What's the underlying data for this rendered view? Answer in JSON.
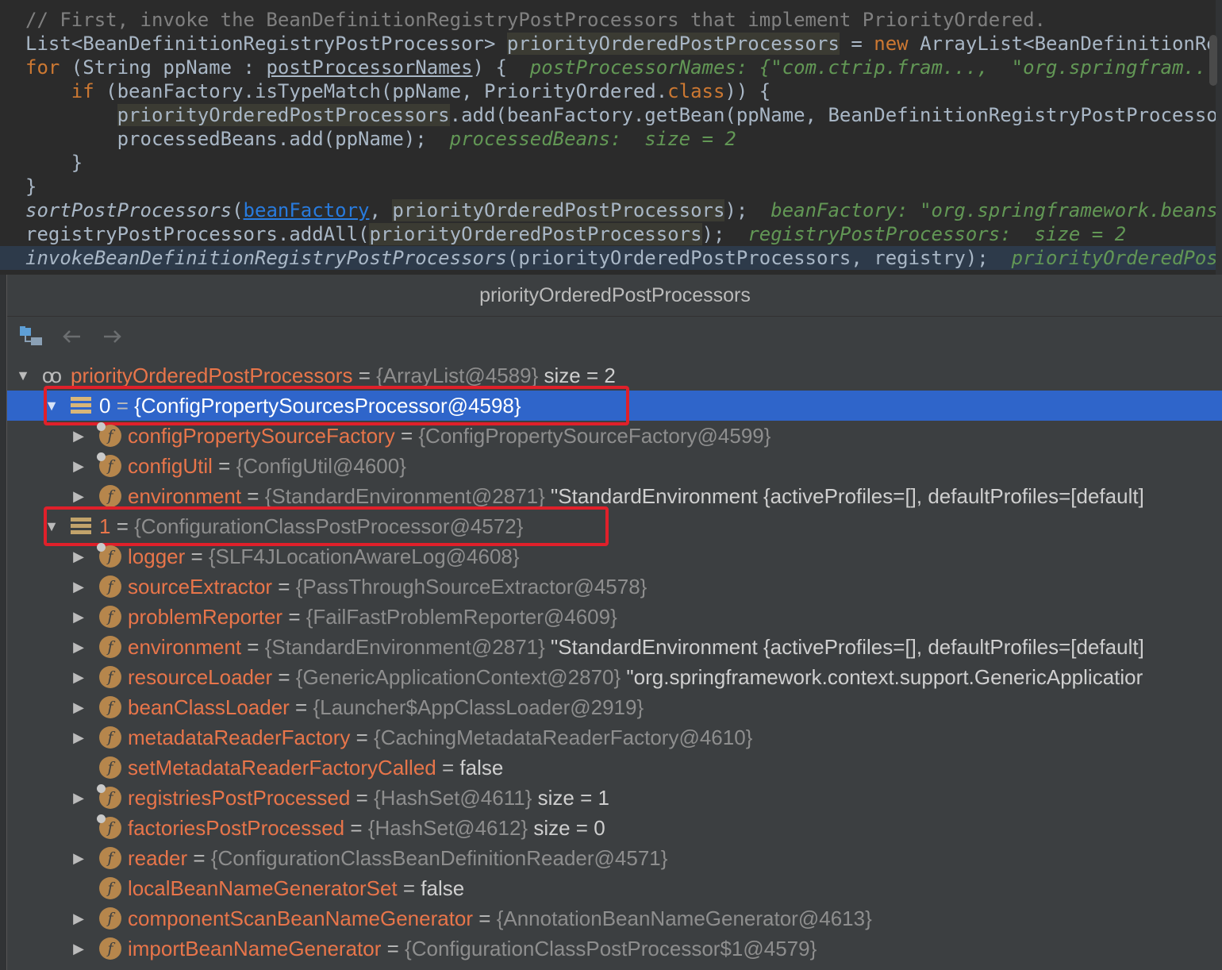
{
  "editor": {
    "lines": [
      {
        "segments": [
          {
            "text": "// First, invoke the BeanDefinitionRegistryPostProcessors that implement PriorityOrdered.",
            "cls": "c-comment"
          }
        ]
      },
      {
        "segments": [
          {
            "text": "List<BeanDefinitionRegistryPostProcessor> "
          },
          {
            "text": "priorityOrderedPostProcessors",
            "cls": "c-hl"
          },
          {
            "text": " = "
          },
          {
            "text": "new",
            "cls": "c-kw"
          },
          {
            "text": " ArrayList<BeanDefinitionReg"
          }
        ]
      },
      {
        "segments": [
          {
            "text": "for",
            "cls": "c-kw"
          },
          {
            "text": " (String ppName : "
          },
          {
            "text": "postProcessorNames",
            "cls": "c-underline"
          },
          {
            "text": ") {  "
          },
          {
            "text": "postProcessorNames: {\"com.ctrip.fram...,  \"org.springfram...}",
            "cls": "c-inline"
          }
        ]
      },
      {
        "segments": [
          {
            "text": "    "
          },
          {
            "text": "if",
            "cls": "c-kw"
          },
          {
            "text": " (beanFactory.isTypeMatch(ppName, PriorityOrdered."
          },
          {
            "text": "class",
            "cls": "c-kw"
          },
          {
            "text": ")) {"
          }
        ]
      },
      {
        "segments": [
          {
            "text": "        "
          },
          {
            "text": "priorityOrderedPostProcessors",
            "cls": "c-hl"
          },
          {
            "text": ".add(beanFactory.getBean(ppName, BeanDefinitionRegistryPostProcessor.c"
          }
        ]
      },
      {
        "segments": [
          {
            "text": "        processedBeans.add(ppName);  "
          },
          {
            "text": "processedBeans:  size = 2",
            "cls": "c-inline"
          }
        ]
      },
      {
        "segments": [
          {
            "text": "    }"
          }
        ]
      },
      {
        "segments": [
          {
            "text": "}"
          }
        ]
      },
      {
        "segments": [
          {
            "text": "sortPostProcessors",
            "cls": "c-italic"
          },
          {
            "text": "("
          },
          {
            "text": "beanFactory",
            "cls": "c-link"
          },
          {
            "text": ", "
          },
          {
            "text": "priorityOrderedPostProcessors",
            "cls": "c-hl"
          },
          {
            "text": ");  "
          },
          {
            "text": "beanFactory: \"org.springframework.beans.fa",
            "cls": "c-inline"
          }
        ]
      },
      {
        "segments": [
          {
            "text": "registryPostProcessors.addAll("
          },
          {
            "text": "priorityOrderedPostProcessors",
            "cls": "c-hl"
          },
          {
            "text": ");  "
          },
          {
            "text": "registryPostProcessors:  size = 2",
            "cls": "c-inline"
          }
        ]
      },
      {
        "segments": [
          {
            "text": "invokeBeanDefinitionRegistryPostProcessors",
            "cls": "c-italic"
          },
          {
            "text": "(priorityOrderedPostProcessors, registry);  "
          },
          {
            "text": "priorityOrderedPostPr",
            "cls": "c-inline"
          }
        ],
        "current": true
      }
    ]
  },
  "popup": {
    "title": "priorityOrderedPostProcessors",
    "toolbar": {
      "icons": [
        "hierarchy-icon",
        "back-arrow-icon",
        "forward-arrow-icon"
      ]
    },
    "tree": [
      {
        "arrow": "▼",
        "icon": "infinity",
        "name": "priorityOrderedPostProcessors",
        "eq": " = ",
        "ref": "{ArrayList@4589}",
        "val": "  size = 2",
        "level": 0
      },
      {
        "arrow": "▼",
        "icon": "array",
        "name": "0",
        "eq": " = ",
        "ref": "{ConfigPropertySourcesProcessor@4598}",
        "val": "",
        "level": 1,
        "selected": true,
        "boxed": true
      },
      {
        "arrow": "▶",
        "icon": "field-locked",
        "name": "configPropertySourceFactory",
        "eq": " = ",
        "ref": "{ConfigPropertySourceFactory@4599}",
        "val": "",
        "level": 2
      },
      {
        "arrow": "▶",
        "icon": "field-locked",
        "name": "configUtil",
        "eq": " = ",
        "ref": "{ConfigUtil@4600}",
        "val": "",
        "level": 2
      },
      {
        "arrow": "▶",
        "icon": "field",
        "name": "environment",
        "eq": " = ",
        "ref": "{StandardEnvironment@2871}",
        "val": " \"StandardEnvironment {activeProfiles=[], defaultProfiles=[default]",
        "level": 2
      },
      {
        "arrow": "▼",
        "icon": "array",
        "name": "1",
        "eq": " = ",
        "ref": "{ConfigurationClassPostProcessor@4572}",
        "val": "",
        "level": 1,
        "boxed": true
      },
      {
        "arrow": "▶",
        "icon": "field-locked",
        "name": "logger",
        "eq": " = ",
        "ref": "{SLF4JLocationAwareLog@4608}",
        "val": "",
        "level": 2
      },
      {
        "arrow": "▶",
        "icon": "field",
        "name": "sourceExtractor",
        "eq": " = ",
        "ref": "{PassThroughSourceExtractor@4578}",
        "val": "",
        "level": 2
      },
      {
        "arrow": "▶",
        "icon": "field",
        "name": "problemReporter",
        "eq": " = ",
        "ref": "{FailFastProblemReporter@4609}",
        "val": "",
        "level": 2
      },
      {
        "arrow": "▶",
        "icon": "field",
        "name": "environment",
        "eq": " = ",
        "ref": "{StandardEnvironment@2871}",
        "val": " \"StandardEnvironment {activeProfiles=[], defaultProfiles=[default]",
        "level": 2
      },
      {
        "arrow": "▶",
        "icon": "field",
        "name": "resourceLoader",
        "eq": " = ",
        "ref": "{GenericApplicationContext@2870}",
        "val": " \"org.springframework.context.support.GenericApplicatior",
        "level": 2
      },
      {
        "arrow": "▶",
        "icon": "field",
        "name": "beanClassLoader",
        "eq": " = ",
        "ref": "{Launcher$AppClassLoader@2919}",
        "val": "",
        "level": 2
      },
      {
        "arrow": "▶",
        "icon": "field",
        "name": "metadataReaderFactory",
        "eq": " = ",
        "ref": "{CachingMetadataReaderFactory@4610}",
        "val": "",
        "level": 2
      },
      {
        "arrow": "",
        "icon": "field",
        "name": "setMetadataReaderFactoryCalled",
        "eq": " = ",
        "ref": "",
        "val": "false",
        "level": 2
      },
      {
        "arrow": "▶",
        "icon": "field-locked",
        "name": "registriesPostProcessed",
        "eq": " = ",
        "ref": "{HashSet@4611}",
        "val": "  size = 1",
        "level": 2
      },
      {
        "arrow": "",
        "icon": "field-locked",
        "name": "factoriesPostProcessed",
        "eq": " = ",
        "ref": "{HashSet@4612}",
        "val": "  size = 0",
        "level": 2
      },
      {
        "arrow": "▶",
        "icon": "field",
        "name": "reader",
        "eq": " = ",
        "ref": "{ConfigurationClassBeanDefinitionReader@4571}",
        "val": "",
        "level": 2
      },
      {
        "arrow": "",
        "icon": "field",
        "name": "localBeanNameGeneratorSet",
        "eq": " = ",
        "ref": "",
        "val": "false",
        "level": 2
      },
      {
        "arrow": "▶",
        "icon": "field",
        "name": "componentScanBeanNameGenerator",
        "eq": " = ",
        "ref": "{AnnotationBeanNameGenerator@4613}",
        "val": "",
        "level": 2
      },
      {
        "arrow": "▶",
        "icon": "field",
        "name": "importBeanNameGenerator",
        "eq": " = ",
        "ref": "{ConfigurationClassPostProcessor$1@4579}",
        "val": "",
        "level": 2
      }
    ]
  },
  "colors": {
    "selection": "#2f65ca",
    "highlight_box": "#e0202a",
    "field_name": "#e8754a",
    "field_icon": "#b6864c"
  }
}
